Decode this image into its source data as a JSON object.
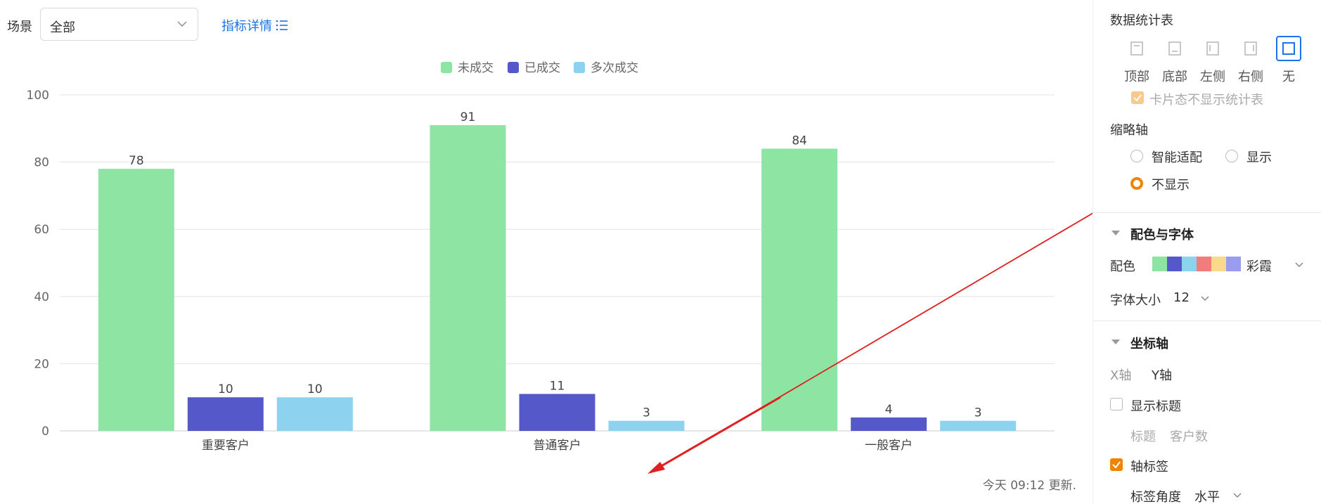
{
  "filter": {
    "scene_label": "场景",
    "scene_value": "全部",
    "metric_link": "指标详情"
  },
  "chart_data": {
    "type": "bar",
    "categories": [
      "重要客户",
      "普通客户",
      "一般客户"
    ],
    "series": [
      {
        "name": "未成交",
        "color": "#8ee4a3",
        "values": [
          78,
          91,
          84
        ]
      },
      {
        "name": "已成交",
        "color": "#5558c9",
        "values": [
          10,
          11,
          4
        ]
      },
      {
        "name": "多次成交",
        "color": "#8dd3f0",
        "values": [
          10,
          3,
          3
        ]
      }
    ],
    "y_ticks": [
      0,
      20,
      40,
      60,
      80,
      100
    ],
    "ylim": [
      0,
      100
    ],
    "legend_position": "top-center",
    "grid": true
  },
  "updated_text": "今天 09:12 更新.",
  "panel": {
    "stats_table_title": "数据统计表",
    "positions": [
      {
        "label": "顶部",
        "icon": "align-top-icon"
      },
      {
        "label": "底部",
        "icon": "align-bottom-icon"
      },
      {
        "label": "左侧",
        "icon": "align-left-icon"
      },
      {
        "label": "右侧",
        "icon": "align-right-icon"
      },
      {
        "label": "无",
        "icon": "square-icon",
        "active": true
      }
    ],
    "card_hide_label": "卡片态不显示统计表",
    "thumb_axis_title": "缩略轴",
    "thumb_options": {
      "smart": "智能适配",
      "show": "显示",
      "hide": "不显示"
    },
    "color_font_title": "配色与字体",
    "color_label": "配色",
    "palette_name": "彩霞",
    "palette": [
      "#8ee4a3",
      "#5558c9",
      "#8dd3f0",
      "#f27b7b",
      "#fbd98c",
      "#9a9cf0"
    ],
    "font_size_label": "字体大小",
    "font_size_value": "12",
    "axis_title": "坐标轴",
    "x_axis_tab": "X轴",
    "y_axis_tab": "Y轴",
    "show_title_label": "显示标题",
    "title_label": "标题",
    "title_value": "客户数",
    "axis_label_label": "轴标签",
    "label_angle_label": "标签角度",
    "label_angle_value": "水平"
  }
}
